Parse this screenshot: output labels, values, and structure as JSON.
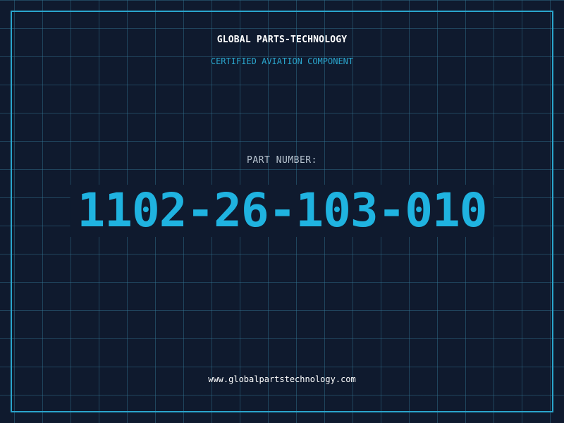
{
  "header": {
    "company_name": "GLOBAL PARTS-TECHNOLOGY",
    "tagline": "CERTIFIED AVIATION COMPONENT"
  },
  "part": {
    "label": "PART NUMBER:",
    "number": "1102-26-103-010"
  },
  "footer": {
    "website": "www.globalpartstechnology.com"
  },
  "colors": {
    "background": "#0f1a2e",
    "grid": "#347896",
    "accent": "#2aa5cc",
    "part_number": "#1fb3e0",
    "label": "#b8c4d0",
    "text": "#ffffff"
  }
}
